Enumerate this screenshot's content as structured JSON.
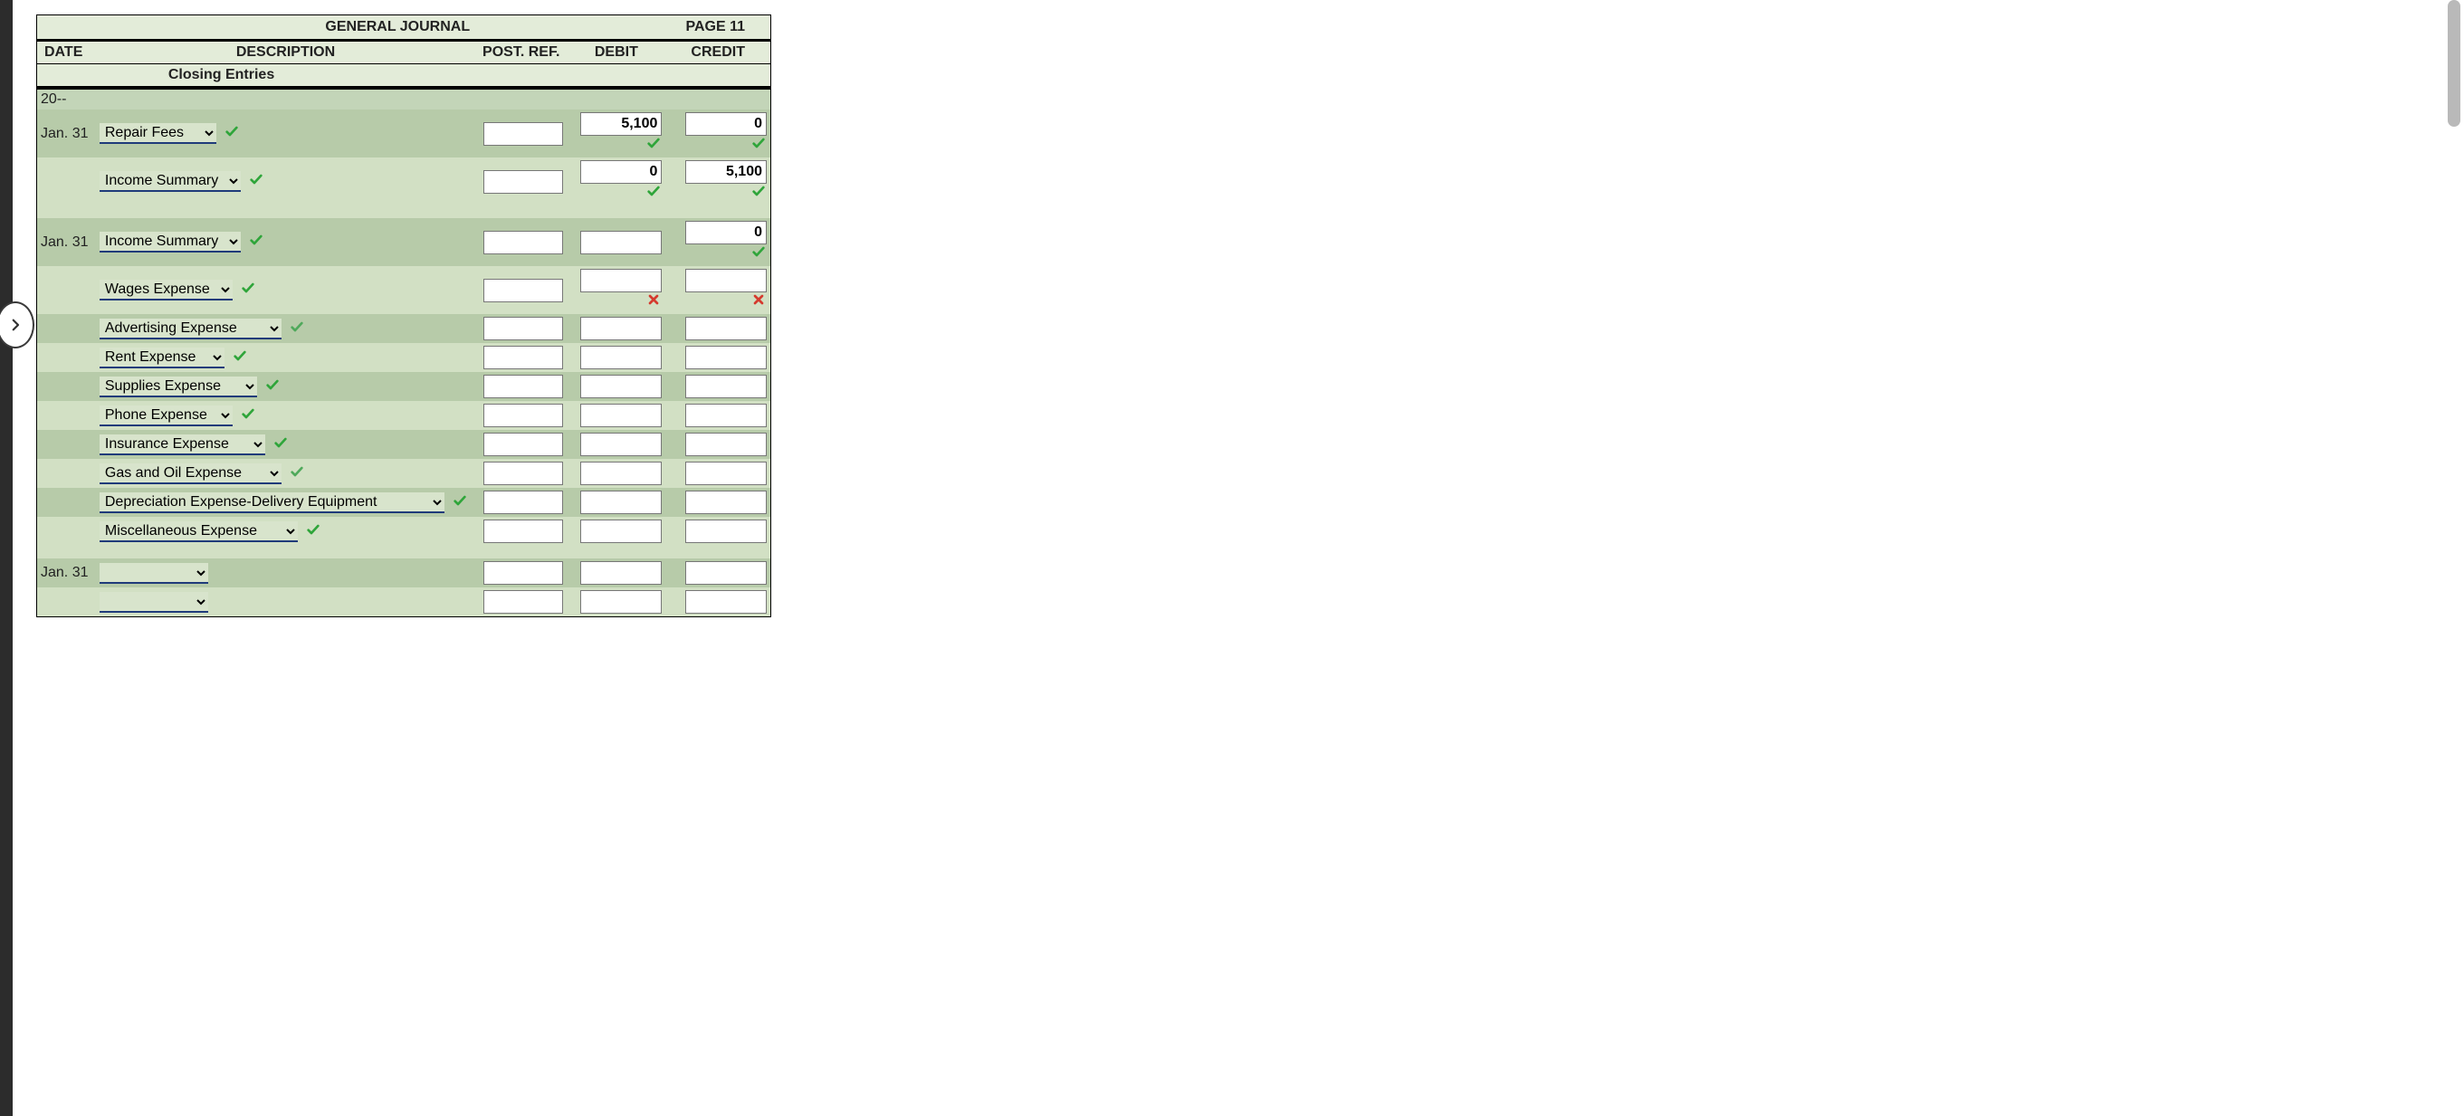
{
  "journal": {
    "title": "GENERAL JOURNAL",
    "page_label": "PAGE 11",
    "columns": {
      "date": "DATE",
      "description": "DESCRIPTION",
      "post_ref": "POST. REF.",
      "debit": "DEBIT",
      "credit": "CREDIT"
    },
    "subheader": "Closing Entries",
    "year": "20--",
    "account_options": [
      "",
      "Repair Fees",
      "Income Summary",
      "Wages Expense",
      "Advertising Expense",
      "Rent Expense",
      "Supplies Expense",
      "Phone Expense",
      "Insurance Expense",
      "Gas and Oil Expense",
      "Depreciation Expense-Delivery Equipment",
      "Miscellaneous Expense"
    ],
    "rows": [
      {
        "date": "Jan. 31",
        "account": "Repair Fees",
        "acct_mark": "check",
        "post_ref": "",
        "debit": "5,100",
        "debit_mark": "check",
        "credit": "0",
        "credit_mark": "check",
        "shade": "dark",
        "indent": 0
      },
      {
        "date": "",
        "account": "Income Summary",
        "acct_mark": "check",
        "post_ref": "",
        "debit": "0",
        "debit_mark": "check",
        "credit": "5,100",
        "credit_mark": "check",
        "shade": "light",
        "indent": 0
      },
      {
        "spacer": true,
        "shade": "light"
      },
      {
        "date": "Jan. 31",
        "account": "Income Summary",
        "acct_mark": "check",
        "post_ref": "",
        "debit": "",
        "debit_mark": "",
        "credit": "0",
        "credit_mark": "check",
        "shade": "dark",
        "indent": 0
      },
      {
        "date": "",
        "account": "Wages Expense",
        "acct_mark": "check",
        "post_ref": "",
        "debit": "",
        "debit_mark": "cross",
        "credit": "",
        "credit_mark": "cross",
        "shade": "light",
        "indent": 0
      },
      {
        "date": "",
        "account": "Advertising Expense",
        "acct_mark": "check-lg",
        "post_ref": "",
        "debit": "",
        "debit_mark": "",
        "credit": "",
        "credit_mark": "",
        "shade": "dark",
        "indent": 0
      },
      {
        "date": "",
        "account": "Rent Expense",
        "acct_mark": "check",
        "post_ref": "",
        "debit": "",
        "debit_mark": "",
        "credit": "",
        "credit_mark": "",
        "shade": "light",
        "indent": 0
      },
      {
        "date": "",
        "account": "Supplies Expense",
        "acct_mark": "check",
        "post_ref": "",
        "debit": "",
        "debit_mark": "",
        "credit": "",
        "credit_mark": "",
        "shade": "dark",
        "indent": 0
      },
      {
        "date": "",
        "account": "Phone Expense",
        "acct_mark": "check",
        "post_ref": "",
        "debit": "",
        "debit_mark": "",
        "credit": "",
        "credit_mark": "",
        "shade": "light",
        "indent": 0
      },
      {
        "date": "",
        "account": "Insurance Expense",
        "acct_mark": "check",
        "post_ref": "",
        "debit": "",
        "debit_mark": "",
        "credit": "",
        "credit_mark": "",
        "shade": "dark",
        "indent": 0
      },
      {
        "date": "",
        "account": "Gas and Oil Expense",
        "acct_mark": "check-lg",
        "post_ref": "",
        "debit": "",
        "debit_mark": "",
        "credit": "",
        "credit_mark": "",
        "shade": "light",
        "indent": 0
      },
      {
        "date": "",
        "account": "Depreciation Expense-Delivery Equipment",
        "acct_mark": "check",
        "post_ref": "",
        "debit": "",
        "debit_mark": "",
        "credit": "",
        "credit_mark": "",
        "shade": "dark",
        "indent": 0
      },
      {
        "date": "",
        "account": "Miscellaneous Expense",
        "acct_mark": "check",
        "post_ref": "",
        "debit": "",
        "debit_mark": "",
        "credit": "",
        "credit_mark": "",
        "shade": "light",
        "indent": 0
      },
      {
        "spacer": true,
        "shade": "light"
      },
      {
        "date": "Jan. 31",
        "account": "",
        "acct_mark": "",
        "post_ref": "",
        "debit": "",
        "debit_mark": "",
        "credit": "",
        "credit_mark": "",
        "shade": "dark",
        "indent": 0
      },
      {
        "date": "",
        "account": "",
        "acct_mark": "",
        "post_ref": "",
        "debit": "",
        "debit_mark": "",
        "credit": "",
        "credit_mark": "",
        "shade": "light",
        "indent": 0
      }
    ]
  },
  "colors": {
    "correct": "#2fa53a",
    "incorrect": "#d53a2e"
  }
}
